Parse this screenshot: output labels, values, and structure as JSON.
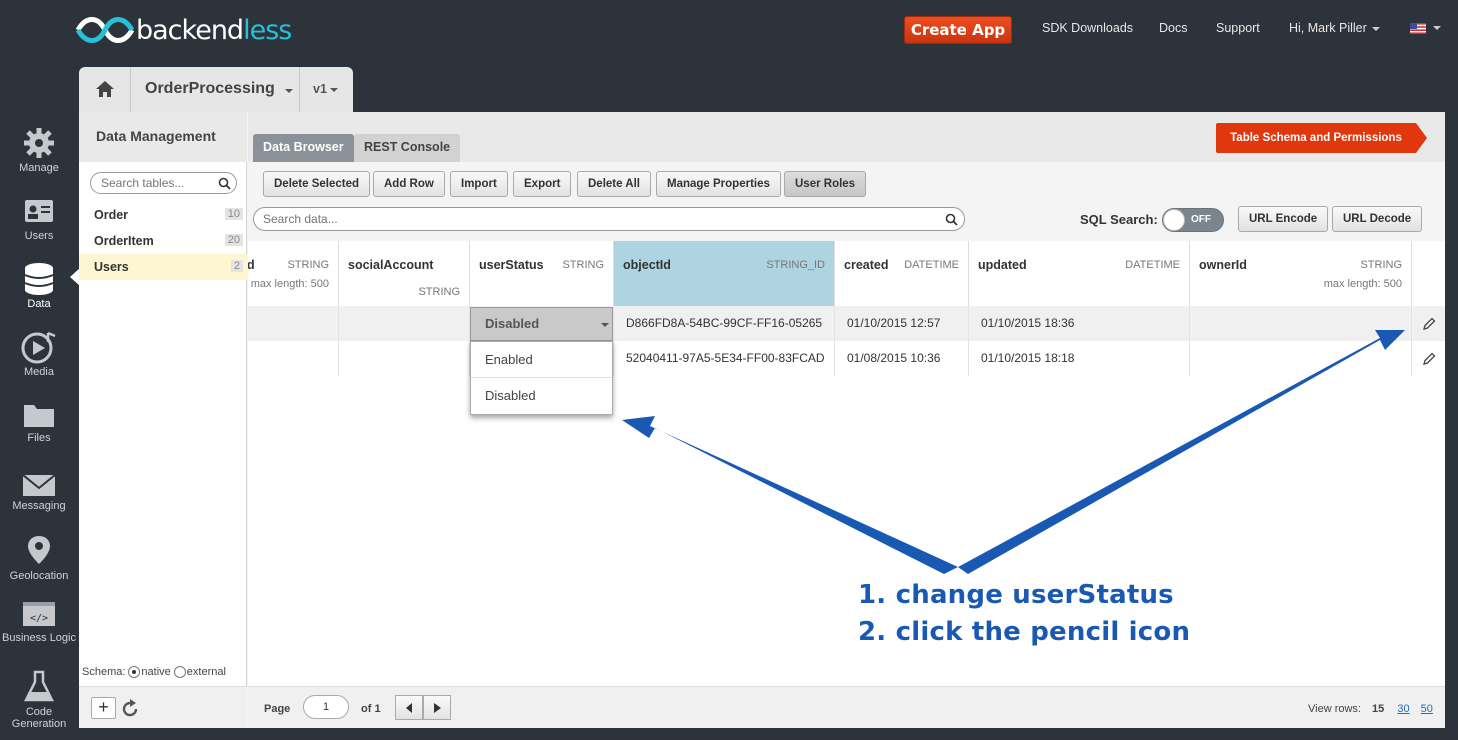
{
  "brand": {
    "name_dark": "backend",
    "name_accent": "less"
  },
  "topbar": {
    "create_app": "Create App",
    "links": [
      "SDK Downloads",
      "Docs",
      "Support"
    ],
    "user": "Hi, Mark Piller"
  },
  "nav": {
    "items": [
      {
        "label": "Manage",
        "icon": "gear-icon"
      },
      {
        "label": "Users",
        "icon": "users-icon"
      },
      {
        "label": "Data",
        "icon": "database-icon"
      },
      {
        "label": "Media",
        "icon": "media-play-icon"
      },
      {
        "label": "Files",
        "icon": "folder-icon"
      },
      {
        "label": "Messaging",
        "icon": "envelope-icon"
      },
      {
        "label": "Geolocation",
        "icon": "map-pin-icon"
      },
      {
        "label": "Business Logic",
        "icon": "code-icon"
      },
      {
        "label": "Code",
        "label2": "Generation",
        "icon": "flask-icon"
      }
    ],
    "active": "Data"
  },
  "app": {
    "name": "OrderProcessing",
    "version": "v1"
  },
  "data_mgmt": {
    "title": "Data Management",
    "search_placeholder": "Search tables...",
    "tables": [
      {
        "name": "Order",
        "count": "10"
      },
      {
        "name": "OrderItem",
        "count": "20"
      },
      {
        "name": "Users",
        "count": "2"
      }
    ],
    "active_table": "Users",
    "schema_label": "Schema:",
    "schema_native": "native",
    "schema_external": "external"
  },
  "tabs": {
    "data_browser": "Data Browser",
    "rest_console": "REST Console"
  },
  "schema_button": "Table Schema and Permissions",
  "toolbar": [
    "Delete Selected",
    "Add Row",
    "Import",
    "Export",
    "Delete All",
    "Manage Properties",
    "User Roles"
  ],
  "search": {
    "placeholder": "Search data...",
    "sql_label": "SQL Search:",
    "sql_state": "OFF",
    "url_encode": "URL Encode",
    "url_decode": "URL Decode"
  },
  "columns": [
    {
      "name": "d",
      "type": "STRING",
      "meta": "max length: 500"
    },
    {
      "name": "socialAccount",
      "type": "",
      "meta": "STRING"
    },
    {
      "name": "userStatus",
      "type": "STRING",
      "meta": ""
    },
    {
      "name": "objectId",
      "type": "STRING_ID",
      "meta": ""
    },
    {
      "name": "created",
      "type": "DATETIME",
      "meta": ""
    },
    {
      "name": "updated",
      "type": "DATETIME",
      "meta": ""
    },
    {
      "name": "ownerId",
      "type": "STRING",
      "meta": "max length: 500"
    }
  ],
  "rows": [
    {
      "objectId": "D866FD8A-54BC-99CF-FF16-05265",
      "created": "01/10/2015 12:57",
      "updated": "01/10/2015 18:36"
    },
    {
      "objectId": "52040411-97A5-5E34-FF00-83FCAD",
      "created": "01/08/2015 10:36",
      "updated": "01/10/2015 18:18"
    }
  ],
  "status_dropdown": {
    "selected": "Disabled",
    "options": [
      "Enabled",
      "Disabled"
    ]
  },
  "footer": {
    "page_label": "Page",
    "page": "1",
    "of_label": "of 1",
    "view_rows_label": "View rows:",
    "current": "15",
    "options": [
      "30",
      "50"
    ]
  },
  "annotation": {
    "line1": "1. change userStatus",
    "line2": "2. click the pencil icon",
    "color": "#1a59b3"
  }
}
